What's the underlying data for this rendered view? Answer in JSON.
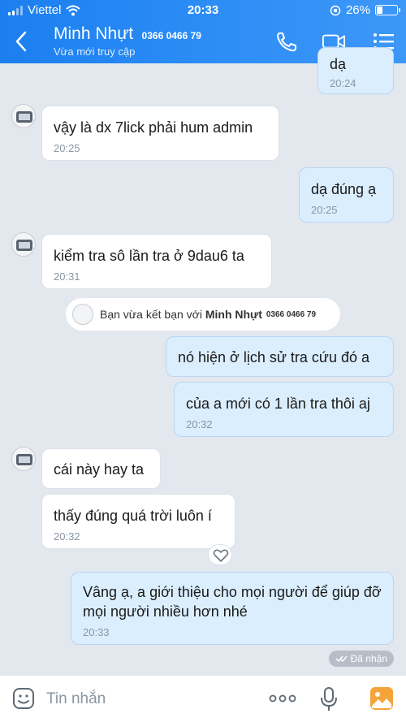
{
  "status_bar": {
    "carrier": "Viettel",
    "time": "20:33",
    "battery_percent": "26%",
    "battery_level": 0.26
  },
  "header": {
    "name": "Minh Nhựt",
    "phone": "0366 0466 79",
    "status": "Vừa mới truy cập"
  },
  "messages": [
    {
      "dir": "out",
      "text": "dạ",
      "time": "20:24"
    },
    {
      "dir": "in",
      "text": "vậy là dx 7lick phải hum admin",
      "time": "20:25"
    },
    {
      "dir": "out",
      "text": "dạ đúng ạ",
      "time": "20:25"
    },
    {
      "dir": "in",
      "text": "kiểm tra sô lần tra ở 9dau6 ta",
      "time": "20:31"
    },
    {
      "dir": "out",
      "text": "nó hiện ở lịch sử tra cứu đó a",
      "time": ""
    },
    {
      "dir": "out",
      "text": "của a mới có 1 lần tra thôi aj",
      "time": "20:32"
    },
    {
      "dir": "in",
      "text": "cái này hay ta",
      "time": ""
    },
    {
      "dir": "in",
      "text": "thấy đúng quá trời luôn í",
      "time": "20:32"
    },
    {
      "dir": "out",
      "text": "Vâng ạ, a giới thiệu cho mọi người để giúp đỡ mọi người nhiều hơn nhé",
      "time": "20:33"
    }
  ],
  "system_notice": {
    "prefix": "Bạn vừa kết bạn với ",
    "name": "Minh Nhựt",
    "phone": "0366 0466 79"
  },
  "seen_label": "Đã nhận",
  "input": {
    "placeholder": "Tin nhắn"
  },
  "colors": {
    "header": "#1b7ff0",
    "outgoing_bubble": "#dbeefe",
    "incoming_bubble": "#ffffff",
    "background": "#e3e7ee"
  }
}
